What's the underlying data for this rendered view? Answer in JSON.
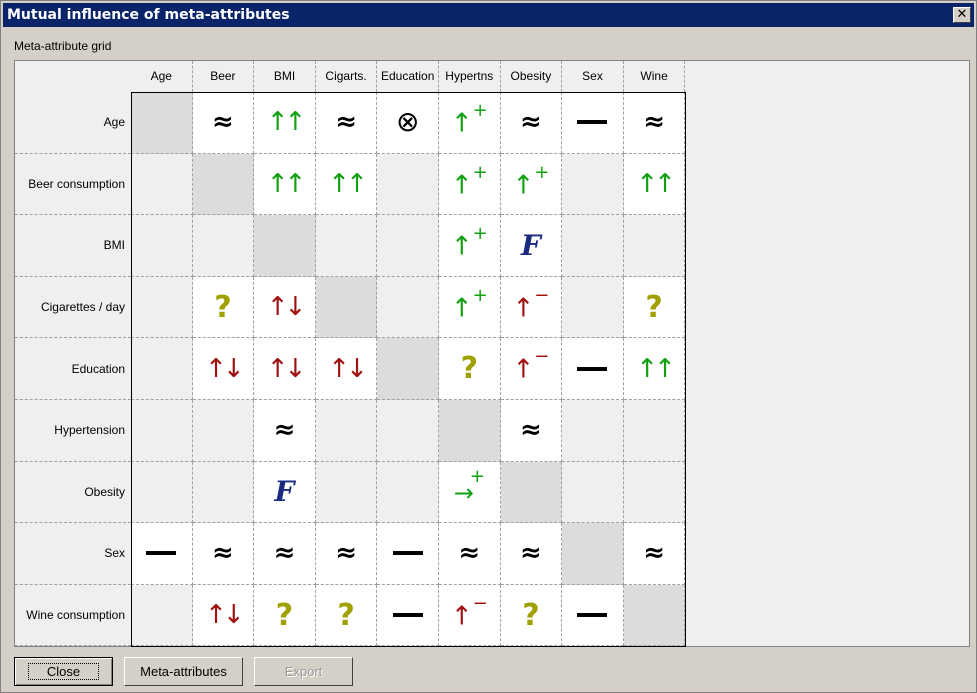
{
  "window": {
    "title": "Mutual influence of meta-attributes",
    "close_glyph": "✕"
  },
  "grid": {
    "label": "Meta-attribute grid",
    "columns": [
      "Age",
      "Beer",
      "BMI",
      "Cigarts.",
      "Education",
      "Hypertns",
      "Obesity",
      "Sex",
      "Wine"
    ],
    "rows": [
      "Age",
      "Beer consumption",
      "BMI",
      "Cigarettes / day",
      "Education",
      "Hypertension",
      "Obesity",
      "Sex",
      "Wine consumption"
    ],
    "cells": [
      [
        "diag",
        "approx",
        "upup",
        "approx",
        "otimes",
        "upplus",
        "approx",
        "dash",
        "approx"
      ],
      [
        "empty",
        "diag",
        "upup",
        "upup",
        "empty",
        "upplus",
        "upplus",
        "empty",
        "upup"
      ],
      [
        "empty",
        "empty",
        "diag",
        "empty",
        "empty",
        "upplus",
        "F",
        "empty",
        "empty"
      ],
      [
        "empty",
        "question",
        "updown",
        "diag",
        "empty",
        "upplus",
        "upminus",
        "empty",
        "question"
      ],
      [
        "empty",
        "updown",
        "updown",
        "updown",
        "diag",
        "question",
        "upminus",
        "dash",
        "upup"
      ],
      [
        "empty",
        "empty",
        "approx",
        "empty",
        "empty",
        "diag",
        "approx",
        "empty",
        "empty"
      ],
      [
        "empty",
        "empty",
        "F",
        "empty",
        "empty",
        "rightplus",
        "diag",
        "empty",
        "empty"
      ],
      [
        "dash",
        "approx",
        "approx",
        "approx",
        "dash",
        "approx",
        "approx",
        "diag",
        "approx"
      ],
      [
        "empty",
        "updown",
        "question",
        "question",
        "dash",
        "upminus",
        "question",
        "dash",
        "diag"
      ]
    ]
  },
  "buttons": {
    "close": "Close",
    "meta_attributes": "Meta-attributes",
    "export": "Export"
  }
}
